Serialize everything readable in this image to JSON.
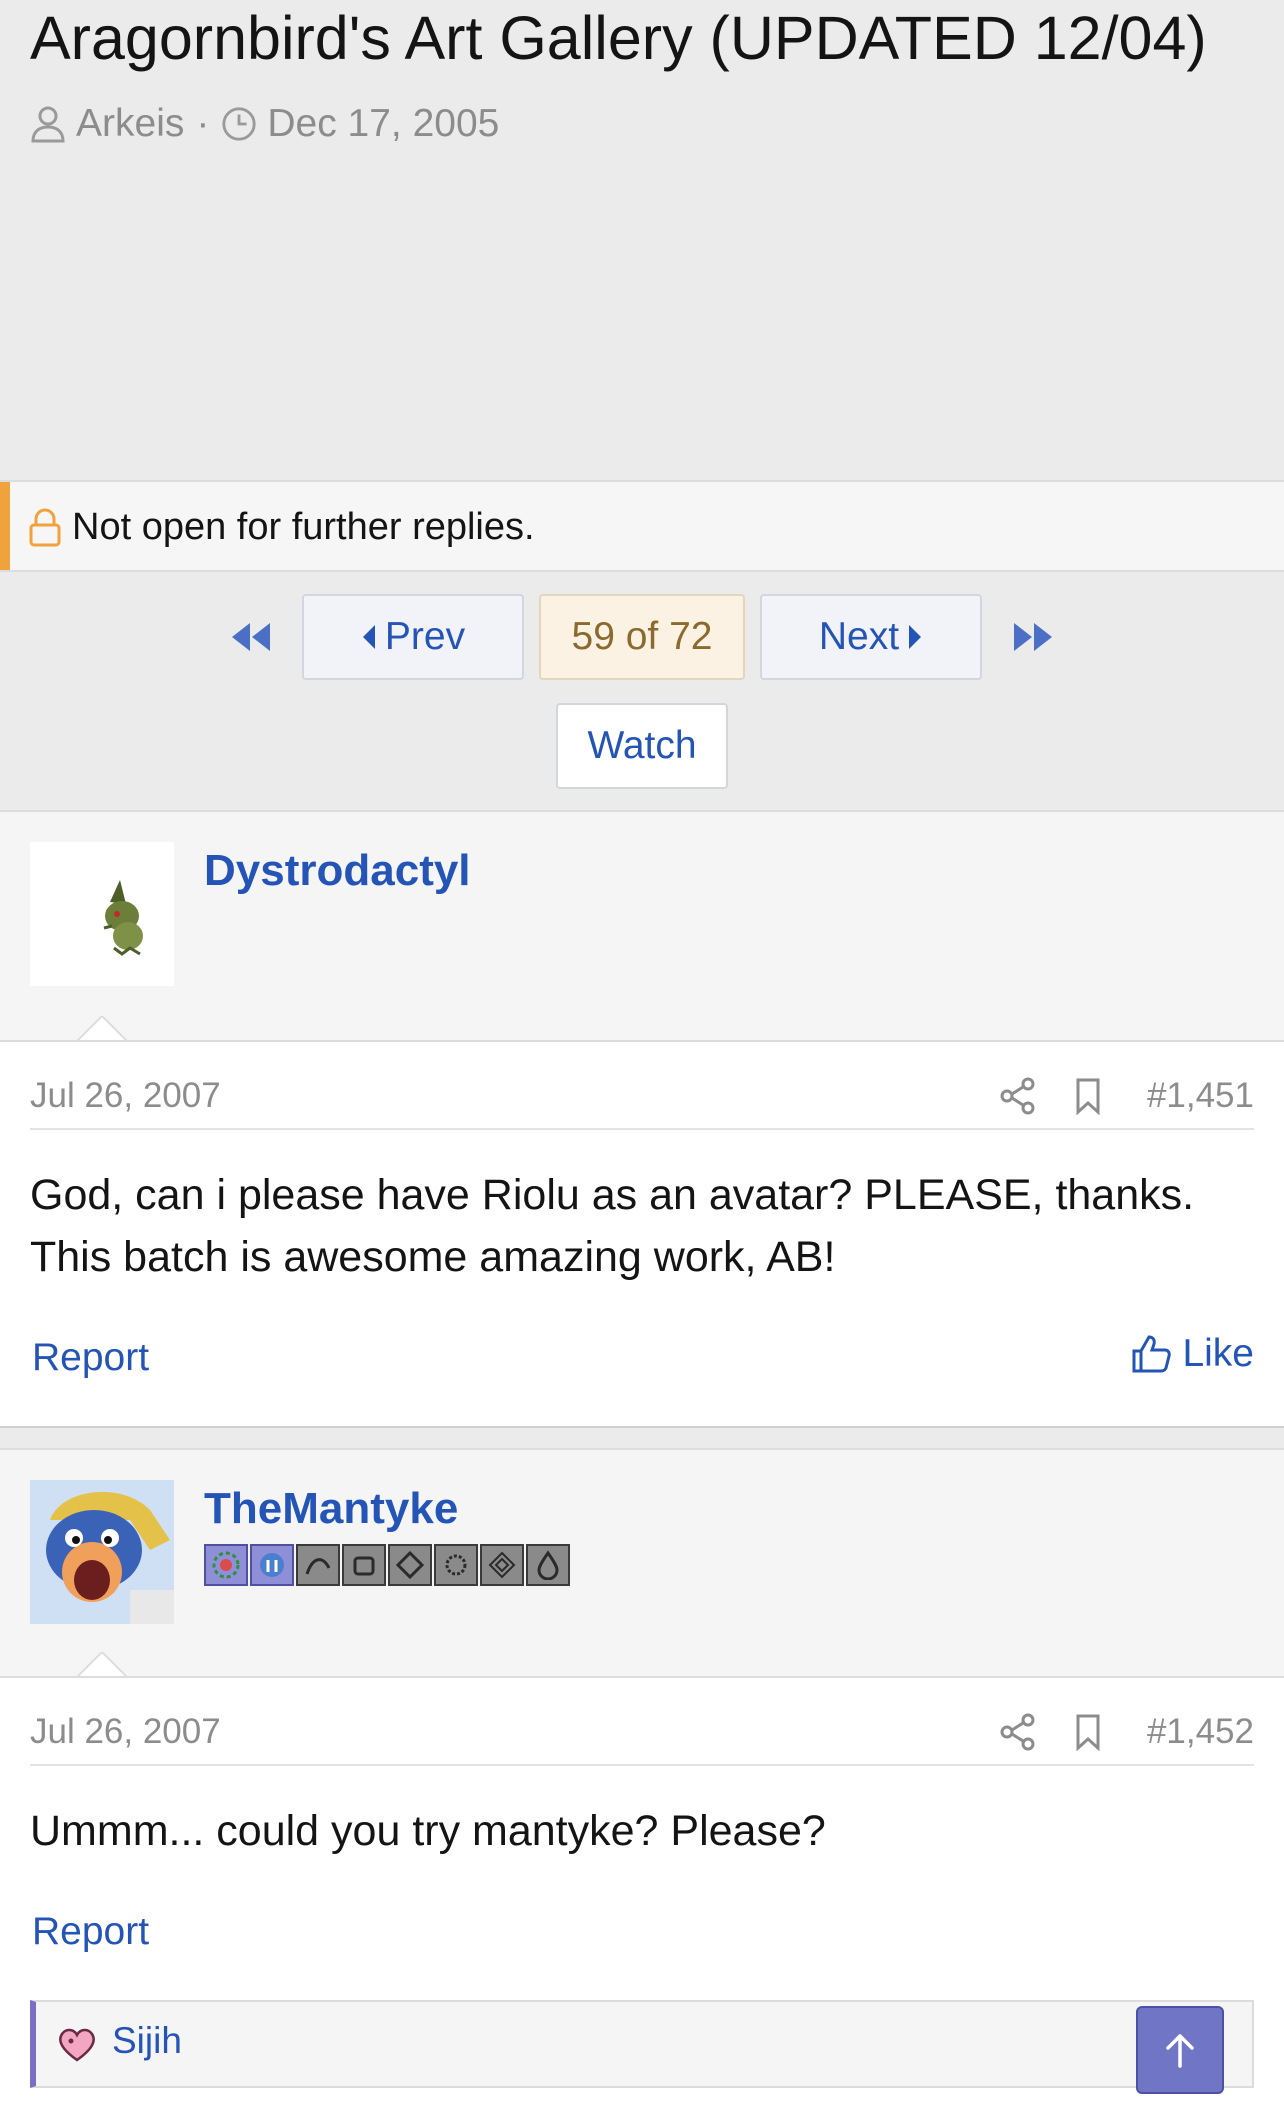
{
  "thread": {
    "title": "Aragornbird's Art Gallery (UPDATED 12/04)",
    "author": "Arkeis",
    "date": "Dec 17, 2005",
    "locked_notice": "Not open for further replies."
  },
  "pager": {
    "prev_label": "Prev",
    "current": "59 of 72",
    "next_label": "Next",
    "watch_label": "Watch"
  },
  "colors": {
    "link": "#2554b7",
    "notice_accent": "#f0a23c",
    "current_page_bg": "#fcf2e3",
    "scroll_top_button": "#7175c6"
  },
  "posts": [
    {
      "username": "Dystrodactyl",
      "avatar_icon": "sprite-avatar",
      "date": "Jul 26, 2007",
      "number": "#1,451",
      "body_lines": [
        "God, can i please have Riolu as an avatar? PLEASE, thanks.",
        "This batch is awesome amazing work, AB!"
      ],
      "report_label": "Report",
      "like_label": "Like"
    },
    {
      "username": "TheMantyke",
      "avatar_icon": "penguin-king-avatar",
      "badge_icons": [
        "badge-1",
        "badge-2",
        "badge-3",
        "badge-4",
        "badge-5",
        "badge-6",
        "badge-7",
        "badge-8"
      ],
      "date": "Jul 26, 2007",
      "number": "#1,452",
      "body_lines": [
        "Ummm... could you try mantyke? Please?"
      ],
      "report_label": "Report",
      "reaction_user": "Sijih"
    }
  ]
}
